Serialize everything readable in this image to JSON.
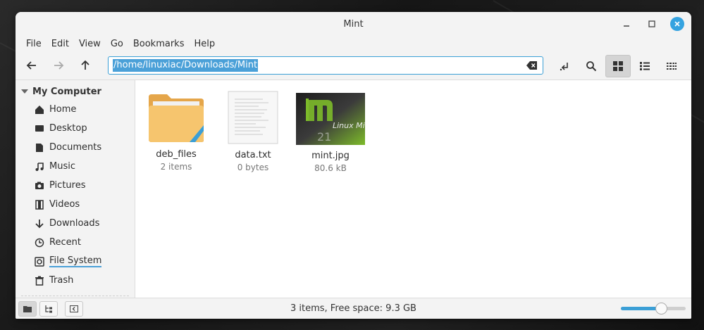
{
  "window": {
    "title": "Mint"
  },
  "menu": [
    "File",
    "Edit",
    "View",
    "Go",
    "Bookmarks",
    "Help"
  ],
  "toolbar": {
    "location": "/home/linuxiac/Downloads/Mint"
  },
  "sidebar": {
    "section": "My Computer",
    "items": [
      {
        "label": "Home",
        "icon": "home-icon"
      },
      {
        "label": "Desktop",
        "icon": "desktop-icon"
      },
      {
        "label": "Documents",
        "icon": "documents-icon"
      },
      {
        "label": "Music",
        "icon": "music-icon"
      },
      {
        "label": "Pictures",
        "icon": "pictures-icon"
      },
      {
        "label": "Videos",
        "icon": "videos-icon"
      },
      {
        "label": "Downloads",
        "icon": "downloads-icon"
      },
      {
        "label": "Recent",
        "icon": "recent-icon"
      },
      {
        "label": "File System",
        "icon": "filesystem-icon"
      },
      {
        "label": "Trash",
        "icon": "trash-icon"
      }
    ]
  },
  "files": [
    {
      "name": "deb_files",
      "detail": "2 items",
      "type": "folder"
    },
    {
      "name": "data.txt",
      "detail": "0 bytes",
      "type": "text"
    },
    {
      "name": "mint.jpg",
      "detail": "80.6 kB",
      "type": "image",
      "thumb_text": "Linux Mint",
      "thumb_number": "21"
    }
  ],
  "status": {
    "text": "3 items, Free space: 9.3 GB",
    "zoom_fraction": 0.63
  },
  "colors": {
    "accent": "#3b9fd6",
    "folder": "#f6c56e",
    "mint_green": "#7dbb2a"
  }
}
